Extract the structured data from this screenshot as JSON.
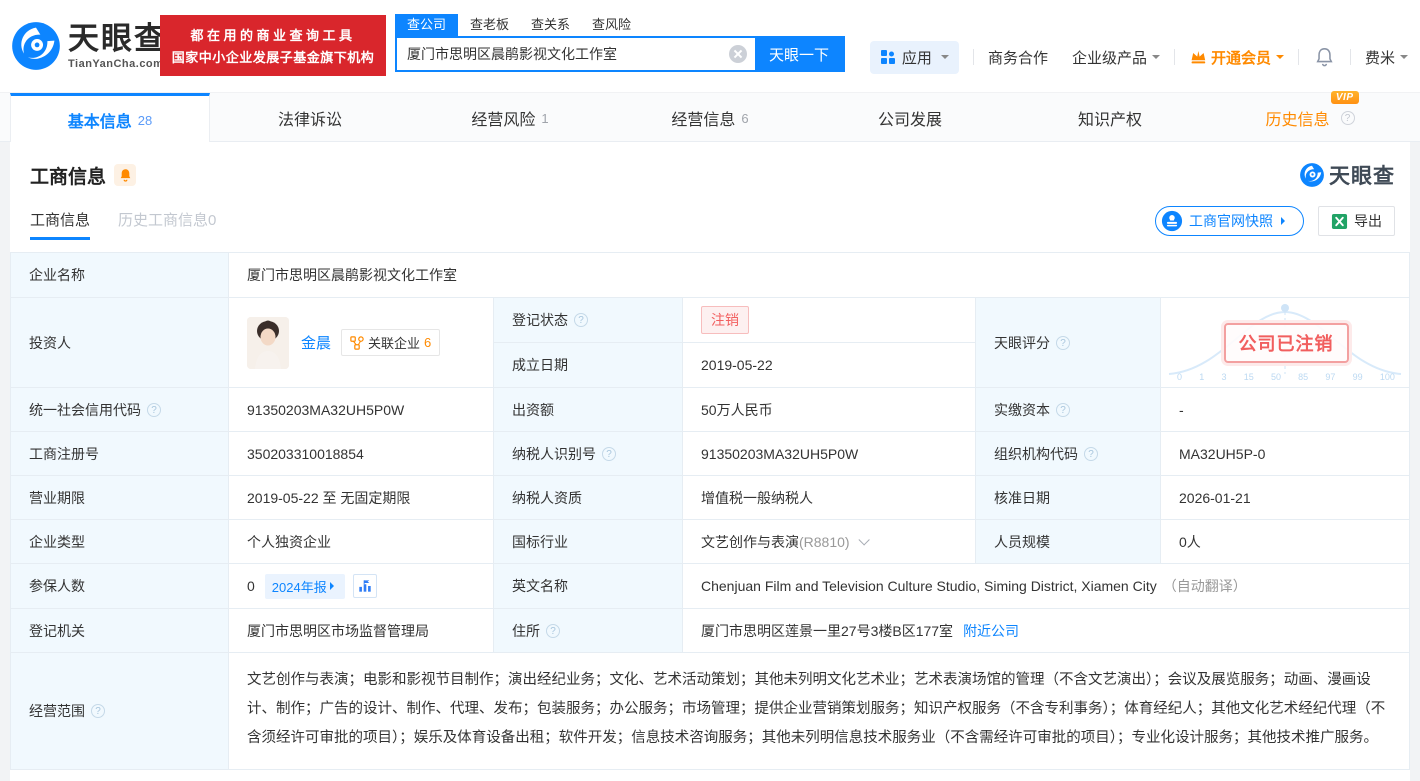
{
  "header": {
    "brand": {
      "name": "天眼查",
      "domain": "TianYanCha.com"
    },
    "promo": {
      "line1": "都在用的商业查询工具",
      "line2": "国家中小企业发展子基金旗下机构"
    },
    "search": {
      "tabs": [
        {
          "label": "查公司"
        },
        {
          "label": "查老板"
        },
        {
          "label": "查关系"
        },
        {
          "label": "查风险"
        }
      ],
      "value": "厦门市思明区晨鹃影视文化工作室",
      "button": "天眼一下"
    },
    "nav": {
      "apps": "应用",
      "coop": "商务合作",
      "enterprise": "企业级产品",
      "vip": "开通会员",
      "user": "费米"
    }
  },
  "tabs": [
    {
      "label": "基本信息",
      "count": "28"
    },
    {
      "label": "法律诉讼",
      "count": ""
    },
    {
      "label": "经营风险",
      "count": "1"
    },
    {
      "label": "经营信息",
      "count": "6"
    },
    {
      "label": "公司发展",
      "count": ""
    },
    {
      "label": "知识产权",
      "count": ""
    },
    {
      "label": "历史信息",
      "count": ""
    }
  ],
  "section": {
    "title": "工商信息",
    "watermark": "天眼查",
    "subtabs": [
      {
        "label": "工商信息"
      },
      {
        "label": "历史工商信息0"
      }
    ],
    "snapshot": "工商官网快照",
    "export": "导出"
  },
  "fields": {
    "company_name": {
      "label": "企业名称",
      "value": "厦门市思明区晨鹃影视文化工作室"
    },
    "investor": {
      "label": "投资人",
      "name": "金晨",
      "related": "关联企业",
      "related_count": "6"
    },
    "reg_status": {
      "label": "登记状态",
      "value": "注销"
    },
    "establish_date": {
      "label": "成立日期",
      "value": "2019-05-22"
    },
    "credit_code": {
      "label": "统一社会信用代码",
      "value": "91350203MA32UH5P0W"
    },
    "capital": {
      "label": "出资额",
      "value": "50万人民币"
    },
    "paid_capital": {
      "label": "实缴资本",
      "value": "-"
    },
    "reg_number": {
      "label": "工商注册号",
      "value": "350203310018854"
    },
    "taxpayer_id": {
      "label": "纳税人识别号",
      "value": "91350203MA32UH5P0W"
    },
    "org_code": {
      "label": "组织机构代码",
      "value": "MA32UH5P-0"
    },
    "business_term": {
      "label": "营业期限",
      "value": "2019-05-22 至 无固定期限"
    },
    "taxpayer_quality": {
      "label": "纳税人资质",
      "value": "增值税一般纳税人"
    },
    "approval_date": {
      "label": "核准日期",
      "value": "2026-01-21"
    },
    "company_type": {
      "label": "企业类型",
      "value": "个人独资企业"
    },
    "industry": {
      "label": "国标行业",
      "value": "文艺创作与表演",
      "code": "(R8810)"
    },
    "staff_size": {
      "label": "人员规模",
      "value": "0人"
    },
    "insured": {
      "label": "参保人数",
      "value": "0",
      "report_badge": "2024年报"
    },
    "english_name": {
      "label": "英文名称",
      "value": "Chenjuan Film and Television Culture Studio, Siming District, Xiamen City",
      "note": "（自动翻译）"
    },
    "reg_authority": {
      "label": "登记机关",
      "value": "厦门市思明区市场监督管理局"
    },
    "address": {
      "label": "住所",
      "value": "厦门市思明区莲景一里27号3楼B区177室",
      "link": "附近公司"
    },
    "scope": {
      "label": "经营范围",
      "value": "文艺创作与表演；电影和影视节目制作；演出经纪业务；文化、艺术活动策划；其他未列明文化艺术业；艺术表演场馆的管理（不含文艺演出）；会议及展览服务；动画、漫画设计、制作；广告的设计、制作、代理、发布；包装服务；办公服务；市场管理；提供企业营销策划服务；知识产权服务（不含专利事务）；体育经纪人；其他文化艺术经纪代理（不含须经许可审批的项目）；娱乐及体育设备出租；软件开发；信息技术咨询服务；其他未列明信息技术服务业（不含需经许可审批的项目）；专业化设计服务；其他技术推广服务。"
    }
  },
  "score": {
    "label": "天眼评分",
    "stamp": "公司已注销",
    "axis": [
      "0",
      "1",
      "3",
      "15",
      "50",
      "85",
      "97",
      "99",
      "100"
    ]
  },
  "icons": {
    "question": "?",
    "vip": "VIP"
  }
}
